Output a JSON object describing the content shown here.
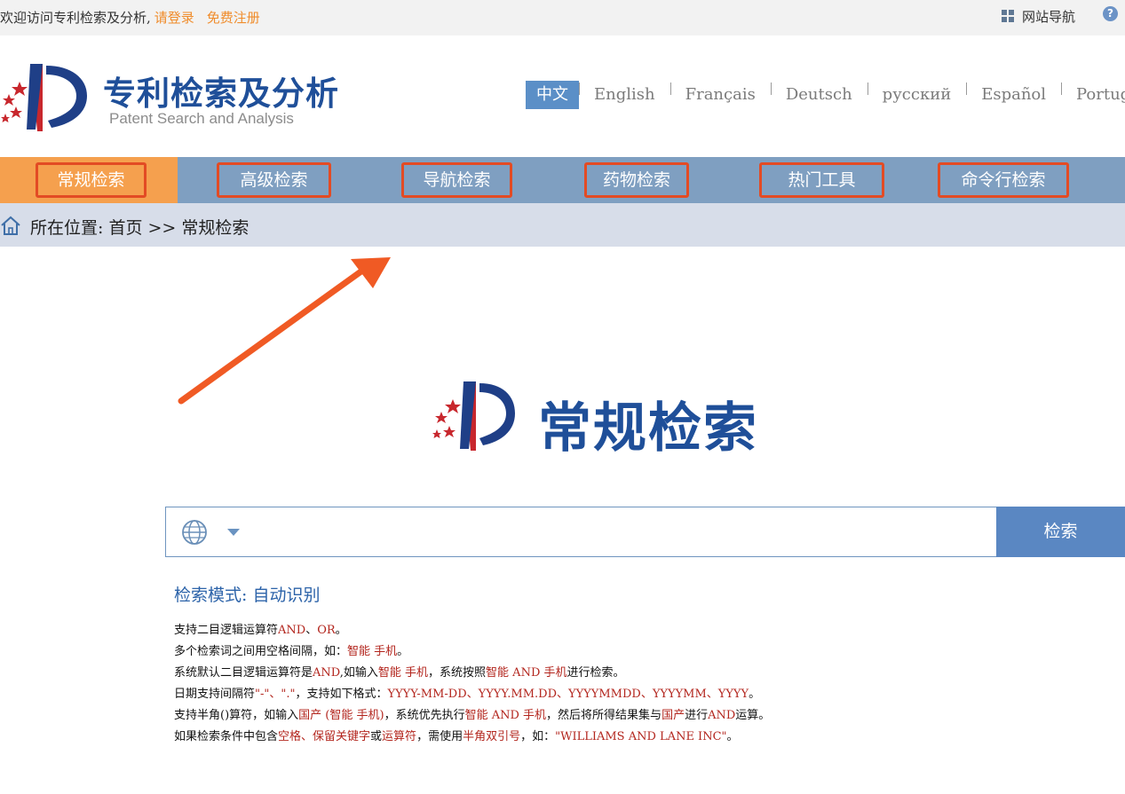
{
  "topbar": {
    "welcome": "欢迎访问专利检索及分析,",
    "login": "请登录",
    "register": "免费注册",
    "site_nav": "网站导航",
    "help_glyph": "?"
  },
  "header": {
    "title": "专利检索及分析",
    "subtitle": "Patent Search and Analysis",
    "languages": [
      "中文",
      "English",
      "Français",
      "Deutsch",
      "русский",
      "Español",
      "Portugu"
    ]
  },
  "nav": {
    "items": [
      "常规检索",
      "高级检索",
      "导航检索",
      "药物检索",
      "热门工具",
      "命令行检索"
    ],
    "active_index": 0
  },
  "breadcrumb": {
    "text": "所在位置: 首页 >> 常规检索"
  },
  "hero": {
    "title": "常规检索"
  },
  "search": {
    "input_value": "",
    "button": "检索"
  },
  "mode": {
    "label": "检索模式: 自动识别"
  },
  "hints": [
    [
      [
        "t",
        "支持二目逻辑运算符"
      ],
      [
        "r",
        "AND"
      ],
      [
        "t",
        "、"
      ],
      [
        "r",
        "OR"
      ],
      [
        "t",
        "。"
      ]
    ],
    [
      [
        "t",
        "多个检索词之间用空格间隔，如："
      ],
      [
        "r",
        "智能 手机"
      ],
      [
        "t",
        "。"
      ]
    ],
    [
      [
        "t",
        "系统默认二目逻辑运算符是"
      ],
      [
        "r",
        "AND"
      ],
      [
        "t",
        ",如输入"
      ],
      [
        "r",
        "智能 手机"
      ],
      [
        "t",
        "，系统按照"
      ],
      [
        "r",
        "智能 AND 手机"
      ],
      [
        "t",
        "进行检索。"
      ]
    ],
    [
      [
        "t",
        "日期支持间隔符"
      ],
      [
        "r",
        "\"-\"、\".\""
      ],
      [
        "t",
        "，支持如下格式："
      ],
      [
        "r",
        "YYYY-MM-DD、YYYY.MM.DD、YYYYMMDD、YYYYMM、YYYY"
      ],
      [
        "t",
        "。"
      ]
    ],
    [
      [
        "t",
        "支持半角()算符，如输入"
      ],
      [
        "r",
        "国产 (智能 手机)"
      ],
      [
        "t",
        "，系统优先执行"
      ],
      [
        "r",
        "智能 AND 手机"
      ],
      [
        "t",
        "，然后将所得结果集与"
      ],
      [
        "r",
        "国产"
      ],
      [
        "t",
        "进行"
      ],
      [
        "r",
        "AND"
      ],
      [
        "t",
        "运算。"
      ]
    ],
    [
      [
        "t",
        "如果检索条件中包含"
      ],
      [
        "r",
        "空格、保留关键字"
      ],
      [
        "t",
        "或"
      ],
      [
        "r",
        "运算符"
      ],
      [
        "t",
        "，需使用"
      ],
      [
        "r",
        "半角双引号"
      ],
      [
        "t",
        "，如："
      ],
      [
        "r",
        "\"WILLIAMS AND LANE INC\""
      ],
      [
        "t",
        "。"
      ]
    ]
  ],
  "colors": {
    "brand_blue": "#1f4f99",
    "nav_blue": "#7f9fc1",
    "nav_active": "#f5a04e",
    "highlight_border": "#e34b24",
    "annotation_arrow": "#f05a24",
    "hint_red": "#b3261e"
  }
}
